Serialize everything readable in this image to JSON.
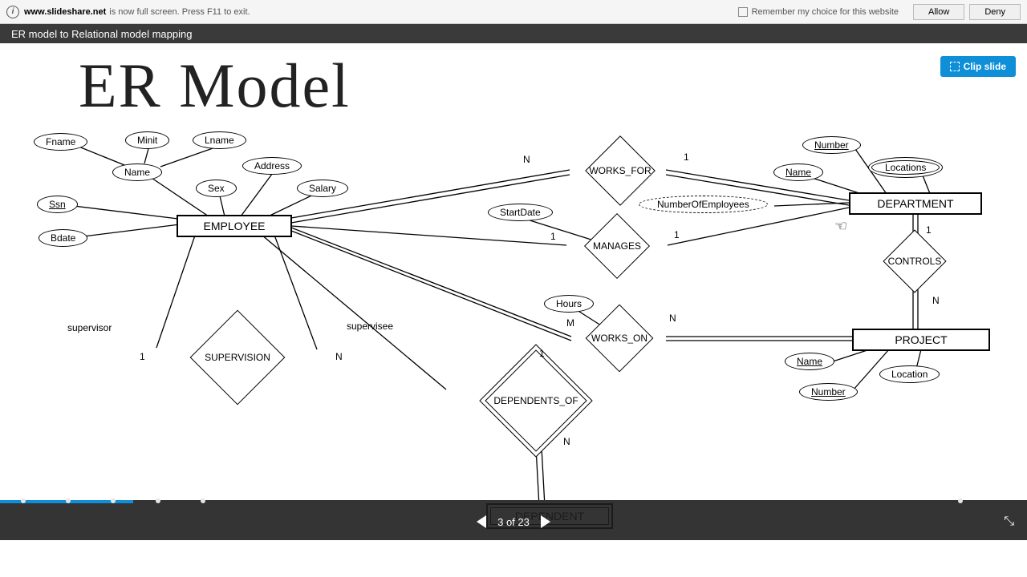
{
  "notif": {
    "domain": "www.slideshare.net",
    "message": "is now full screen. Press F11 to exit.",
    "remember": "Remember my choice for this website",
    "allow": "Allow",
    "deny": "Deny"
  },
  "title_bar": "ER model to Relational model mapping",
  "slide": {
    "title": "ER Model",
    "clip": "Clip slide",
    "entities": {
      "employee": "EMPLOYEE",
      "department": "DEPARTMENT",
      "project": "PROJECT",
      "dependent": "DEPENDENT"
    },
    "relationships": {
      "works_for": "WORKS_FOR",
      "manages": "MANAGES",
      "works_on": "WORKS_ON",
      "controls": "CONTROLS",
      "supervision": "SUPERVISION",
      "dependents_of": "DEPENDENTS_OF"
    },
    "attributes": {
      "fname": "Fname",
      "minit": "Minit",
      "lname": "Lname",
      "name_emp": "Name",
      "ssn": "Ssn",
      "bdate": "Bdate",
      "sex": "Sex",
      "address": "Address",
      "salary": "Salary",
      "start_date": "StartDate",
      "number_of_employees": "NumberOfEmployees",
      "dept_name": "Name",
      "dept_number": "Number",
      "locations": "Locations",
      "hours": "Hours",
      "proj_name": "Name",
      "proj_number": "Number",
      "location": "Location"
    },
    "cardinalities": {
      "n": "N",
      "m": "M",
      "one": "1"
    },
    "roles": {
      "supervisor": "supervisor",
      "supervisee": "supervisee"
    }
  },
  "nav": {
    "page_indicator": "3 of 23",
    "current": 3,
    "total": 23
  }
}
